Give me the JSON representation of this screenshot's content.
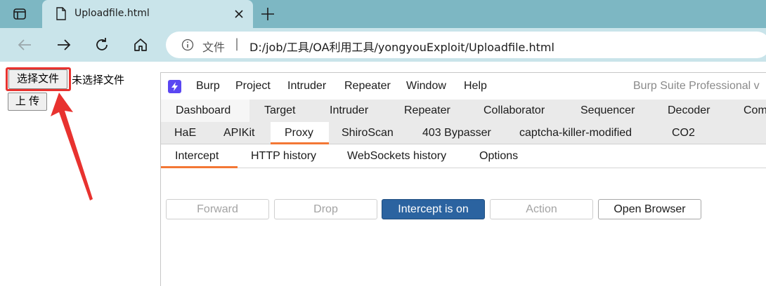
{
  "browser": {
    "tab_title": "Uploadfile.html",
    "address_label": "文件",
    "address_separator": "|",
    "url": "D:/job/工具/OA利用工具/yongyouExploit/Uploadfile.html"
  },
  "page": {
    "choose_file_label": "选择文件",
    "no_file_text": "未选择文件",
    "upload_label": "上 传"
  },
  "burp": {
    "menu": [
      "Burp",
      "Project",
      "Intruder",
      "Repeater",
      "Window",
      "Help"
    ],
    "title": "Burp Suite Professional v",
    "tabs_row1": [
      "Dashboard",
      "Target",
      "Intruder",
      "Repeater",
      "Collaborator",
      "Sequencer",
      "Decoder",
      "Com"
    ],
    "tabs_row2": [
      "HaE",
      "APIKit",
      "Proxy",
      "ShiroScan",
      "403 Bypasser",
      "captcha-killer-modified",
      "CO2"
    ],
    "active_tab": "Proxy",
    "proxy_subtabs": [
      "Intercept",
      "HTTP history",
      "WebSockets history",
      "Options"
    ],
    "active_subtab": "Intercept",
    "buttons": {
      "forward": "Forward",
      "drop": "Drop",
      "intercept": "Intercept is on",
      "action": "Action",
      "open_browser": "Open Browser"
    },
    "colors": {
      "accent": "#f37735",
      "intercept_on": "#2b63a0",
      "logo": "#5a46f2"
    }
  },
  "annotation": {
    "highlight_color": "#e8322f"
  }
}
